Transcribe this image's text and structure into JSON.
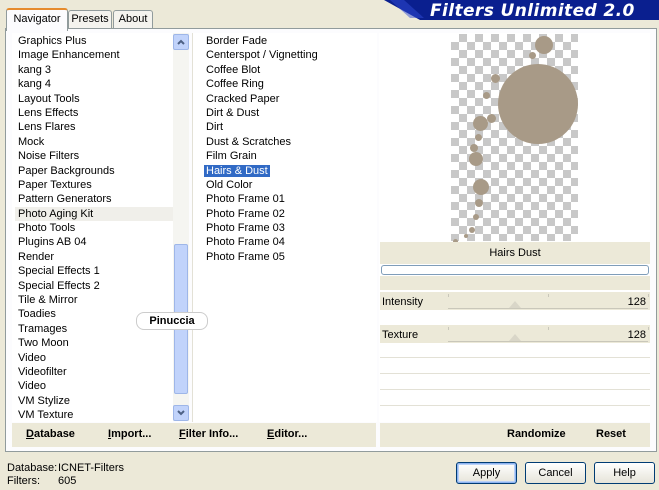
{
  "window": {
    "banner_title": "Filters Unlimited 2.0"
  },
  "tabs": [
    {
      "label": "Navigator",
      "active": true
    },
    {
      "label": "Presets",
      "active": false
    },
    {
      "label": "About",
      "active": false
    }
  ],
  "categories": [
    "Graphics Plus",
    "Image Enhancement",
    "kang 3",
    "kang 4",
    "Layout Tools",
    "Lens Effects",
    "Lens Flares",
    "Mock",
    "Noise Filters",
    "Paper Backgrounds",
    "Paper Textures",
    "Pattern Generators",
    "Photo Aging Kit",
    "Photo Tools",
    "Plugins AB 04",
    "Render",
    "Special Effects 1",
    "Special Effects 2",
    "Tile & Mirror",
    "Toadies",
    "Tramages",
    "Two Moon",
    "Video",
    "Videofilter",
    "Video",
    "VM Stylize",
    "VM Texture"
  ],
  "categories_selected": "Photo Aging Kit",
  "filters": [
    "Border Fade",
    "Centerspot / Vignetting",
    "Coffee Blot",
    "Coffee Ring",
    "Cracked Paper",
    "Dirt & Dust",
    "Dirt",
    "Dust & Scratches",
    "Film Grain",
    "Hairs & Dust",
    "Old Color",
    "Photo Frame 01",
    "Photo Frame 02",
    "Photo Frame 03",
    "Photo Frame 04",
    "Photo Frame 05"
  ],
  "filters_selected": "Hairs & Dust",
  "watermark": "Pinuccia",
  "preview": {
    "filter_name": "Hairs  Dust",
    "dust_color": "#a89a87",
    "params": [
      {
        "label": "Intensity",
        "value": "128"
      },
      {
        "label": "Texture",
        "value": "128"
      }
    ]
  },
  "bottom_bar": {
    "database": "Database",
    "import": "Import...",
    "filter_info": "Filter Info...",
    "editor": "Editor...",
    "randomize": "Randomize",
    "reset": "Reset"
  },
  "status": {
    "database_label": "Database:",
    "database_value": "ICNET-Filters",
    "filters_label": "Filters:",
    "filters_value": "605"
  },
  "dialog_buttons": {
    "apply": "Apply",
    "cancel": "Cancel",
    "help": "Help"
  }
}
